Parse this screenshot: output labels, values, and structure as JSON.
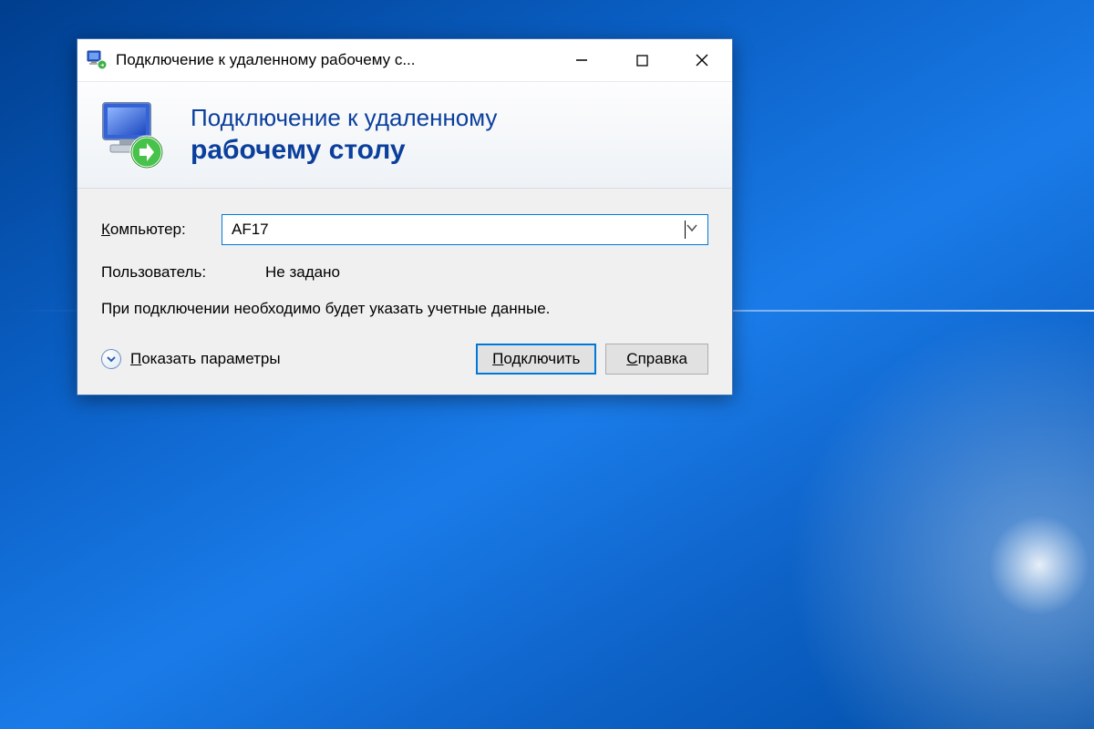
{
  "window": {
    "title": "Подключение к удаленному рабочему с..."
  },
  "banner": {
    "line1": "Подключение к удаленному",
    "line2": "рабочему столу"
  },
  "form": {
    "computer_label_pre": "К",
    "computer_label_rest": "омпьютер:",
    "computer_value": "AF17",
    "user_label": "Пользователь:",
    "user_value": "Не задано",
    "hint": "При подключении необходимо будет указать учетные данные."
  },
  "footer": {
    "show_options_pre": "П",
    "show_options_rest": "оказать параметры",
    "connect_pre": "П",
    "connect_rest": "одключить",
    "help_pre": "С",
    "help_rest": "правка"
  }
}
